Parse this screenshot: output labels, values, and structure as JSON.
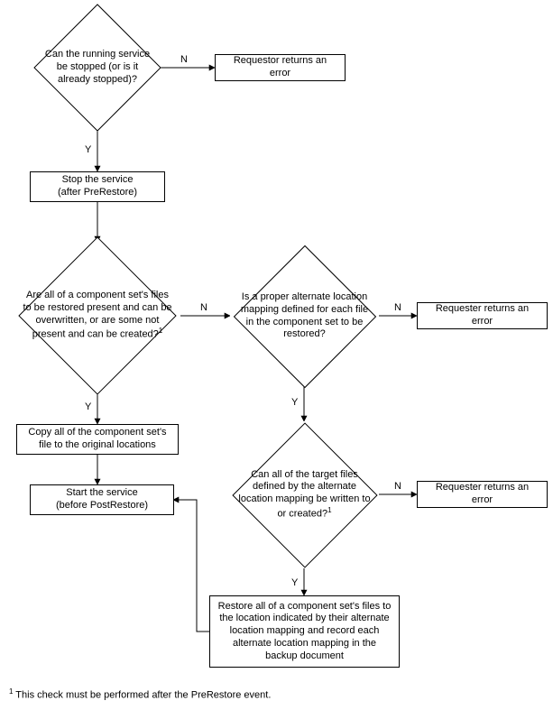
{
  "nodes": {
    "d1": "Can the running service be stopped (or is it already stopped)?",
    "r1": "Requestor returns an error",
    "p1": "Stop the service\n(after PreRestore)",
    "d2": "Are all of a component set's files to be restored present and can be overwritten, or are some not present and can be created?",
    "d2_sup": "1",
    "d3": "Is a proper alternate location mapping defined for each file in the component set to be restored?",
    "r2": "Requester returns an error",
    "p2": "Copy all of the component set's file to the original locations",
    "p3": "Start the service\n(before PostRestore)",
    "d4": "Can all of the target files defined by the alternate location mapping be written to or created?",
    "d4_sup": "1",
    "r3": "Requester returns an error",
    "p4": "Restore all of a component set's files to the location indicated by their alternate location mapping and record each alternate location mapping in the backup document"
  },
  "edges": {
    "d1_no": "N",
    "d1_yes": "Y",
    "d2_no": "N",
    "d2_yes": "Y",
    "d3_no": "N",
    "d3_yes": "Y",
    "d4_no": "N",
    "d4_yes": "Y"
  },
  "footnote": {
    "marker": "1",
    "text": " This check must be performed after the PreRestore event."
  }
}
